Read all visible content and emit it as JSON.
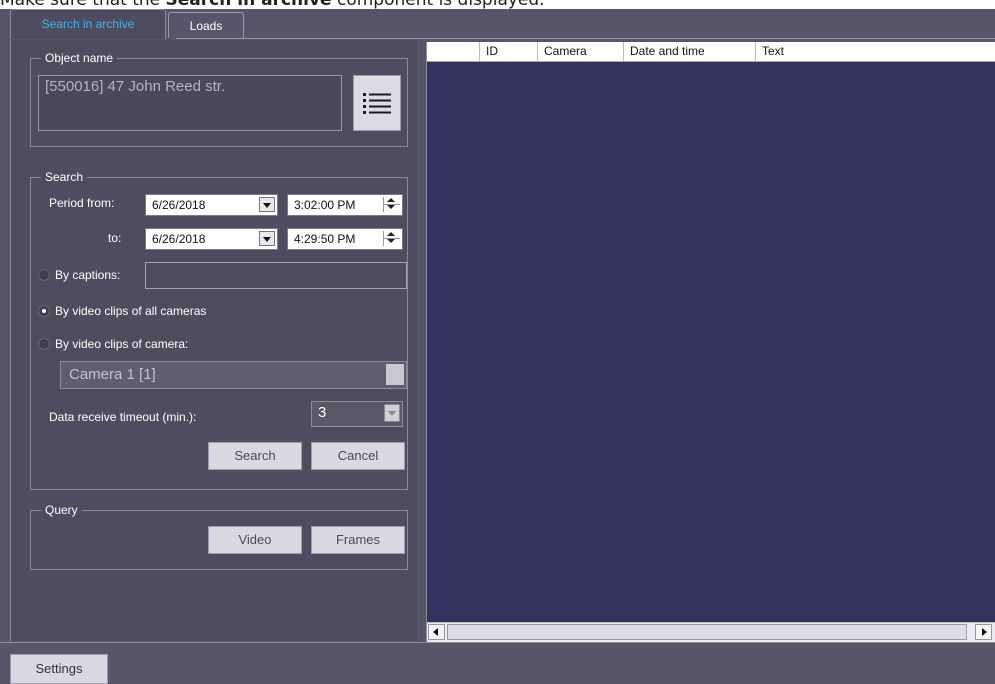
{
  "doc": {
    "prefix": "Make sure that the ",
    "bold": "Search in archive",
    "suffix": " component is displayed."
  },
  "tabs": [
    {
      "label": "Search in archive",
      "active": true
    },
    {
      "label": "Loads",
      "active": false
    }
  ],
  "object_group": {
    "legend": "Object name",
    "value": "[550016] 47 John Reed str.",
    "list_icon": "list-icon"
  },
  "search_group": {
    "legend": "Search",
    "period_from_label": "Period from:",
    "to_label": "to:",
    "from_date": "6/26/2018",
    "from_time": "3:02:00 PM",
    "to_date": "6/26/2018",
    "to_time": "4:29:50 PM",
    "by_captions_label": "By captions:",
    "by_captions_value": "",
    "by_all_cameras_label": "By video clips of all cameras",
    "by_camera_label": "By video clips of camera:",
    "camera_value": "Camera 1 [1]",
    "timeout_label": "Data receive timeout (min.):",
    "timeout_value": "3",
    "search_button": "Search",
    "cancel_button": "Cancel",
    "selected_option": "By video clips of all cameras"
  },
  "query_group": {
    "legend": "Query",
    "video_button": "Video",
    "frames_button": "Frames"
  },
  "results_table": {
    "columns": [
      "ID",
      "Camera",
      "Date and time",
      "Text"
    ],
    "rows": []
  },
  "footer": {
    "settings_button": "Settings"
  },
  "colors": {
    "panel_bg": "#575669",
    "grid_bg": "#33335f",
    "active_tab_text": "#3db2f0"
  }
}
